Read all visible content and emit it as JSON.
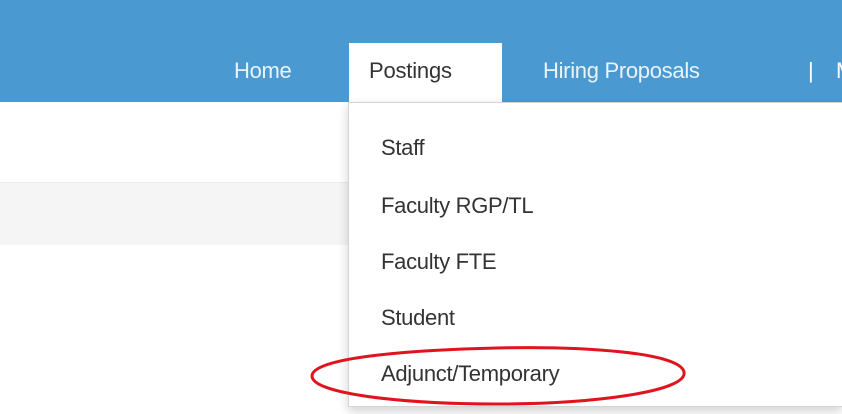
{
  "nav": {
    "home": "Home",
    "postings": "Postings",
    "hiring_proposals": "Hiring Proposals",
    "separator": "|",
    "cut_item": "M"
  },
  "dropdown": {
    "items": [
      {
        "label": "Staff"
      },
      {
        "label": "Faculty RGP/TL"
      },
      {
        "label": "Faculty FTE"
      },
      {
        "label": "Student"
      },
      {
        "label": "Adjunct/Temporary"
      }
    ]
  },
  "colors": {
    "nav_bar": "#4a9ad1",
    "highlight_ellipse": "#e0141e"
  }
}
